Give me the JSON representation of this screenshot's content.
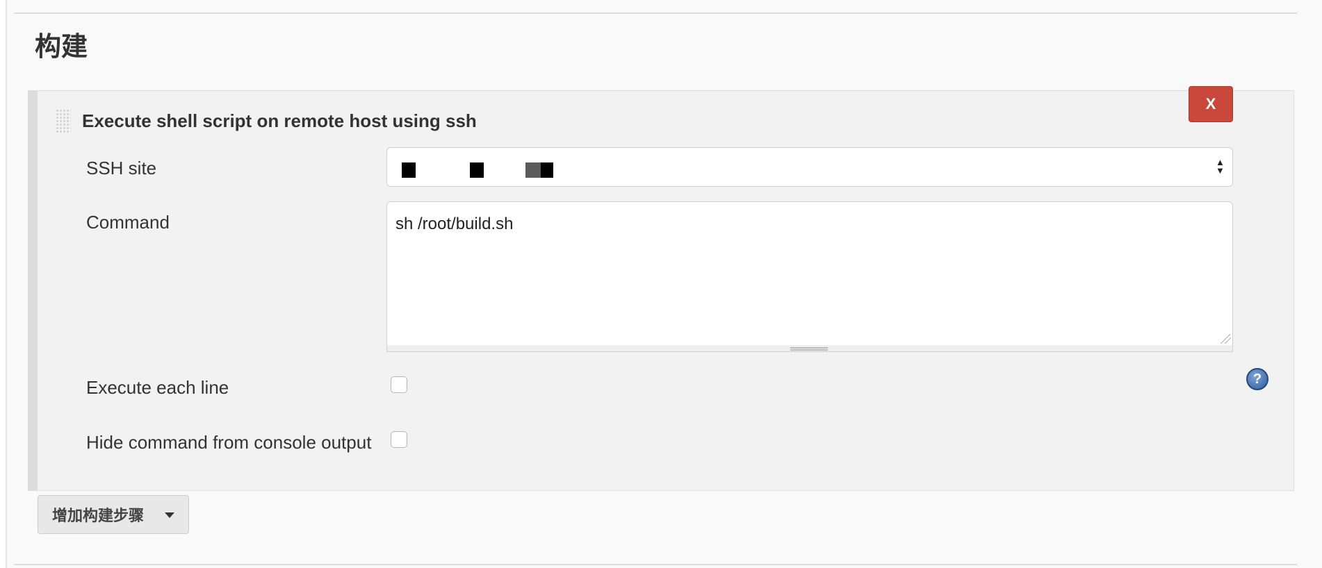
{
  "section": {
    "title": "构建"
  },
  "build_step": {
    "title": "Execute shell script on remote host using ssh",
    "delete_label": "X",
    "ssh_site": {
      "label": "SSH site",
      "value_redacted": true
    },
    "command": {
      "label": "Command",
      "value": "sh /root/build.sh"
    },
    "execute_each_line": {
      "label": "Execute each line",
      "checked": false
    },
    "hide_command": {
      "label": "Hide command from console output",
      "checked": false
    },
    "help_icon": "question-icon"
  },
  "add_step_button": {
    "label": "增加构建步骤",
    "icon": "caret-down-icon"
  },
  "colors": {
    "delete_button": "#c9473b",
    "panel_bg": "#f2f2f2",
    "help_icon": "#2e5c9c"
  }
}
